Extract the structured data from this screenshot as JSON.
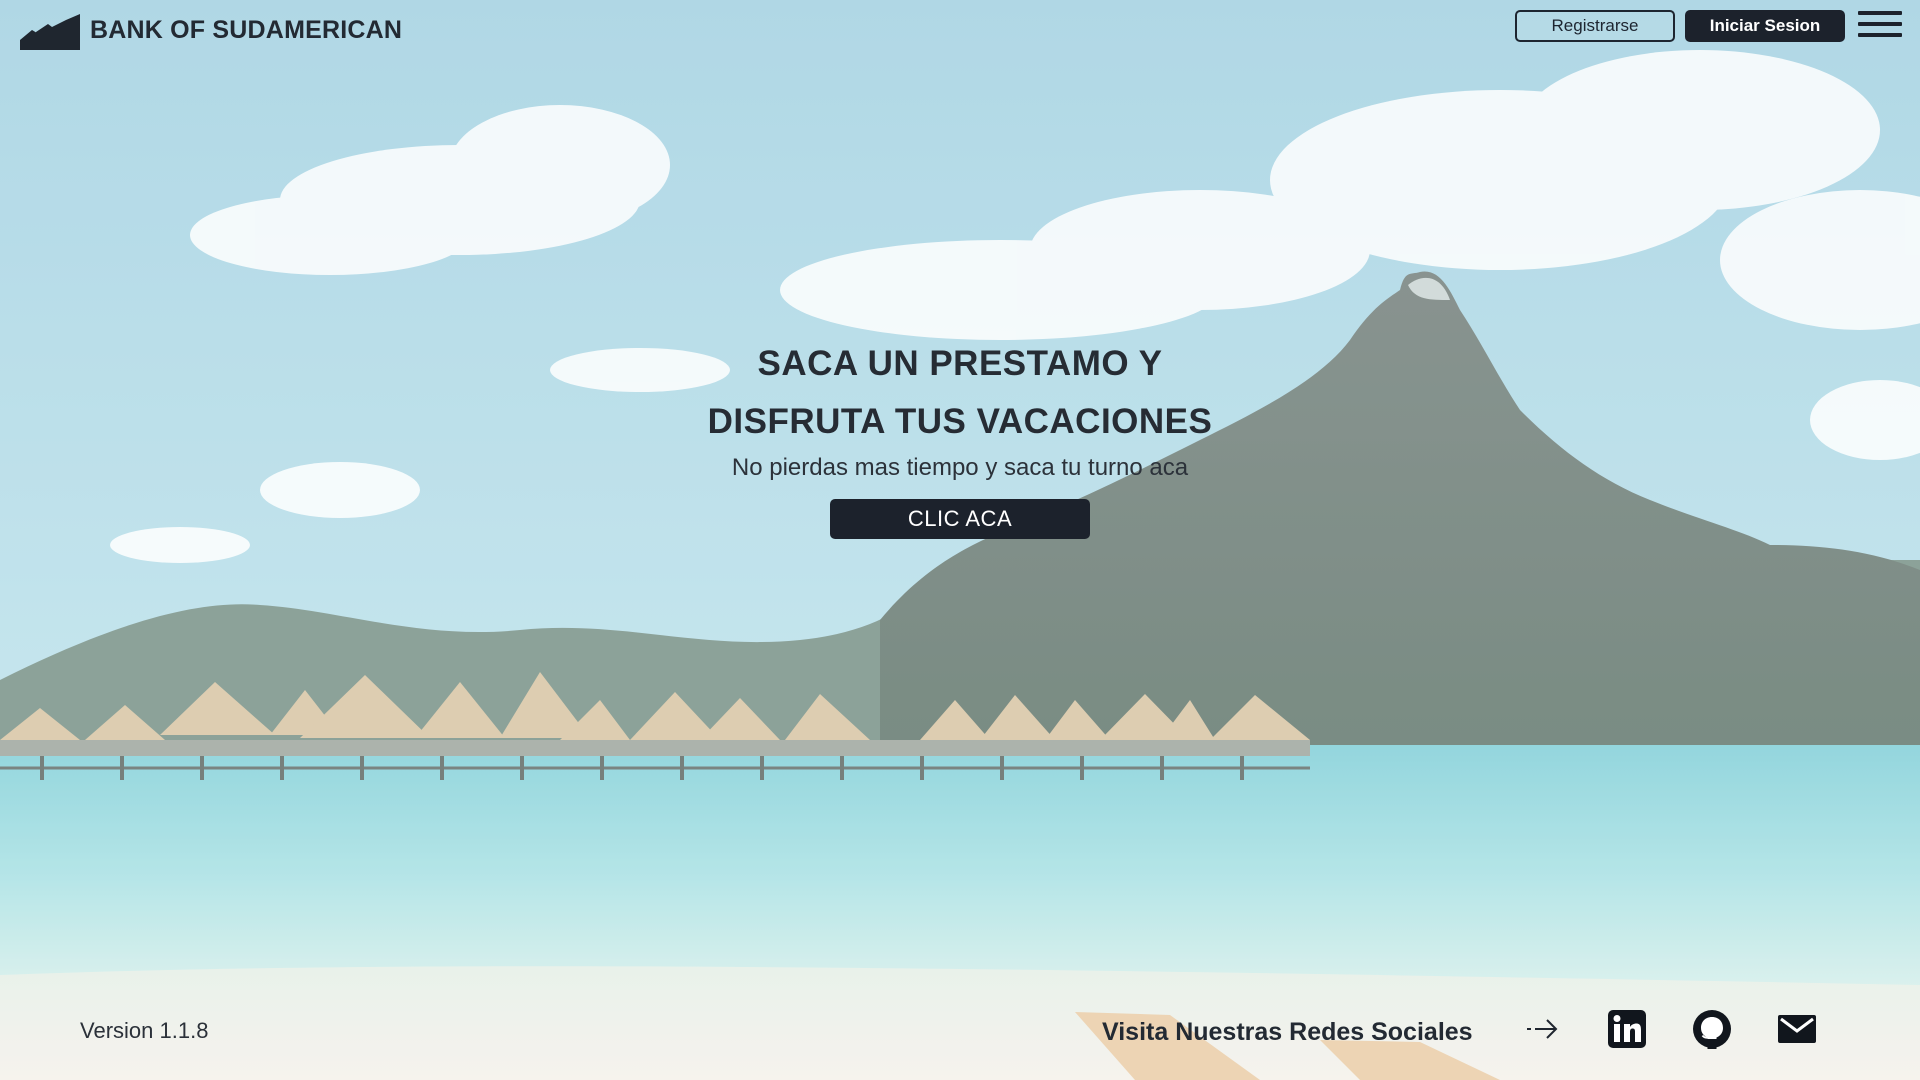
{
  "header": {
    "brand_name": "BANK OF SUDAMERICAN",
    "register_label": "Registrarse",
    "login_label": "Iniciar Sesion",
    "menu_icon": "hamburger-menu-icon"
  },
  "hero": {
    "title_line1": "SACA UN PRESTAMO Y",
    "title_line2": "DISFRUTA TUS VACACIONES",
    "subtitle": "No pierdas mas tiempo y saca tu turno aca",
    "cta_label": "CLIC ACA"
  },
  "footer": {
    "version": "Version 1.1.8",
    "social_label": "Visita Nuestras Redes Sociales",
    "icons": [
      "arrow-right-icon",
      "linkedin-icon",
      "github-icon",
      "mail-icon"
    ]
  },
  "colors": {
    "primary_dark": "#1c222c",
    "text": "#232a33",
    "sky": "#a7d6e6",
    "sea": "#8fd3dc"
  }
}
